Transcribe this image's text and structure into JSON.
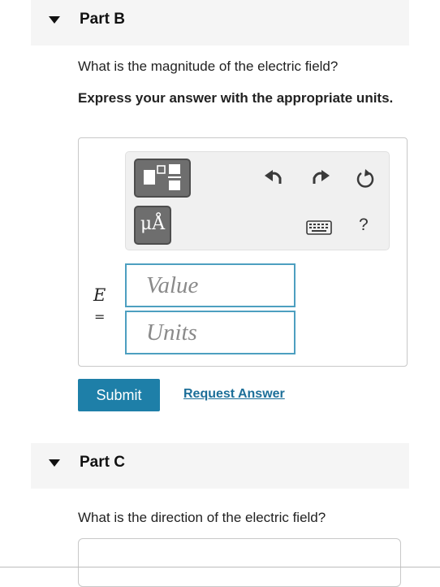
{
  "partB": {
    "header": "Part B",
    "question": "What is the magnitude of the electric field?",
    "instruction": "Express your answer with the appropriate units.",
    "variable": "E",
    "equals": "=",
    "value_placeholder": "Value",
    "units_placeholder": "Units",
    "units_button_label": "μÅ",
    "help_label": "?",
    "submit_label": "Submit",
    "request_answer_label": "Request Answer"
  },
  "partC": {
    "header": "Part C",
    "question": "What is the direction of the electric field?"
  },
  "colors": {
    "submit_bg": "#1e7fa8",
    "link": "#1d6f99",
    "field_border": "#4d9fc0",
    "header_bg": "#f5f5f5",
    "tool_button_bg": "#6e6e6e"
  },
  "icons": [
    "templates-icon",
    "units-icon",
    "undo-icon",
    "redo-icon",
    "reset-icon",
    "keyboard-icon",
    "help-icon",
    "collapse-caret-icon"
  ]
}
